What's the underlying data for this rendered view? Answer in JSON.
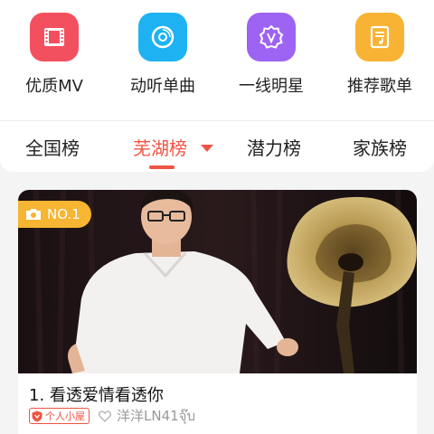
{
  "features": [
    {
      "label": "优质MV",
      "icon": "mv-film-icon",
      "color": "#f3505f"
    },
    {
      "label": "动听单曲",
      "icon": "vinyl-disc-icon",
      "color": "#1fb2f2"
    },
    {
      "label": "一线明星",
      "icon": "star-badge-icon",
      "color": "#9d63f3"
    },
    {
      "label": "推荐歌单",
      "icon": "playlist-doc-icon",
      "color": "#f8b334"
    }
  ],
  "tabs": [
    {
      "label": "全国榜"
    },
    {
      "label": "芜湖榜",
      "active": true
    },
    {
      "label": "潜力榜"
    },
    {
      "label": "家族榜"
    }
  ],
  "accent_color": "#ef5444",
  "song": {
    "rank_badge": "NO.1",
    "title": "1. 看透爱情看透你",
    "house_tag": "个人小屋",
    "author": "洋洋LN41จุ๊บ"
  }
}
